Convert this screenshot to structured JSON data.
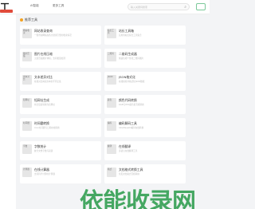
{
  "header": {
    "logo": "工具",
    "nav": [
      "AI智能",
      "更多工具"
    ],
    "search_placeholder": "输入关键词搜索",
    "search_accent": "搜索"
  },
  "section": {
    "title": "推荐工具"
  },
  "cards": [
    {
      "thumb": "网站收录",
      "title": "网站收录查询",
      "desc": "一键查询网站在各大搜索引擎的收录情况"
    },
    {
      "thumb": "站长工具",
      "title": "站长工具箱",
      "desc": "实用的站长综合工具集合"
    },
    {
      "thumb": "图片压缩",
      "title": "图片在线压缩",
      "desc": "无损压缩图片体积，支持批量处理"
    },
    {
      "thumb": "二维码",
      "title": "二维码生成器",
      "desc": "快速生成个性化二维码图片"
    },
    {
      "thumb": "文本对比",
      "title": "文本差异对比",
      "desc": "在线对比两段文本的不同之处"
    },
    {
      "thumb": "JSON",
      "title": "JSON格式化",
      "desc": "在线校验并格式化JSON数据"
    },
    {
      "thumb": "短网址",
      "title": "短网址生成",
      "desc": "将长链接转换为短网址"
    },
    {
      "thumb": "颜色",
      "title": "颜色代码转换",
      "desc": "RGB与HEX颜色值互相转换"
    },
    {
      "thumb": "时间戳",
      "title": "时间戳转换",
      "desc": "Unix时间戳与日期在线转换"
    },
    {
      "thumb": "编码",
      "title": "编码解码工具",
      "desc": "URL/Base64编码在线转换"
    },
    {
      "thumb": "字数",
      "title": "字数统计",
      "desc": "统计文章字数与段落"
    },
    {
      "thumb": "翻译",
      "title": "在线翻译",
      "desc": "多语言在线翻译工具"
    },
    {
      "thumb": "计算器",
      "title": "在线计算器",
      "desc": "支持科学计算的计算器"
    },
    {
      "thumb": "格式",
      "title": "文档格式转换工具",
      "desc": "常见文档格式互相转换"
    }
  ],
  "watermark": "依能收录网"
}
